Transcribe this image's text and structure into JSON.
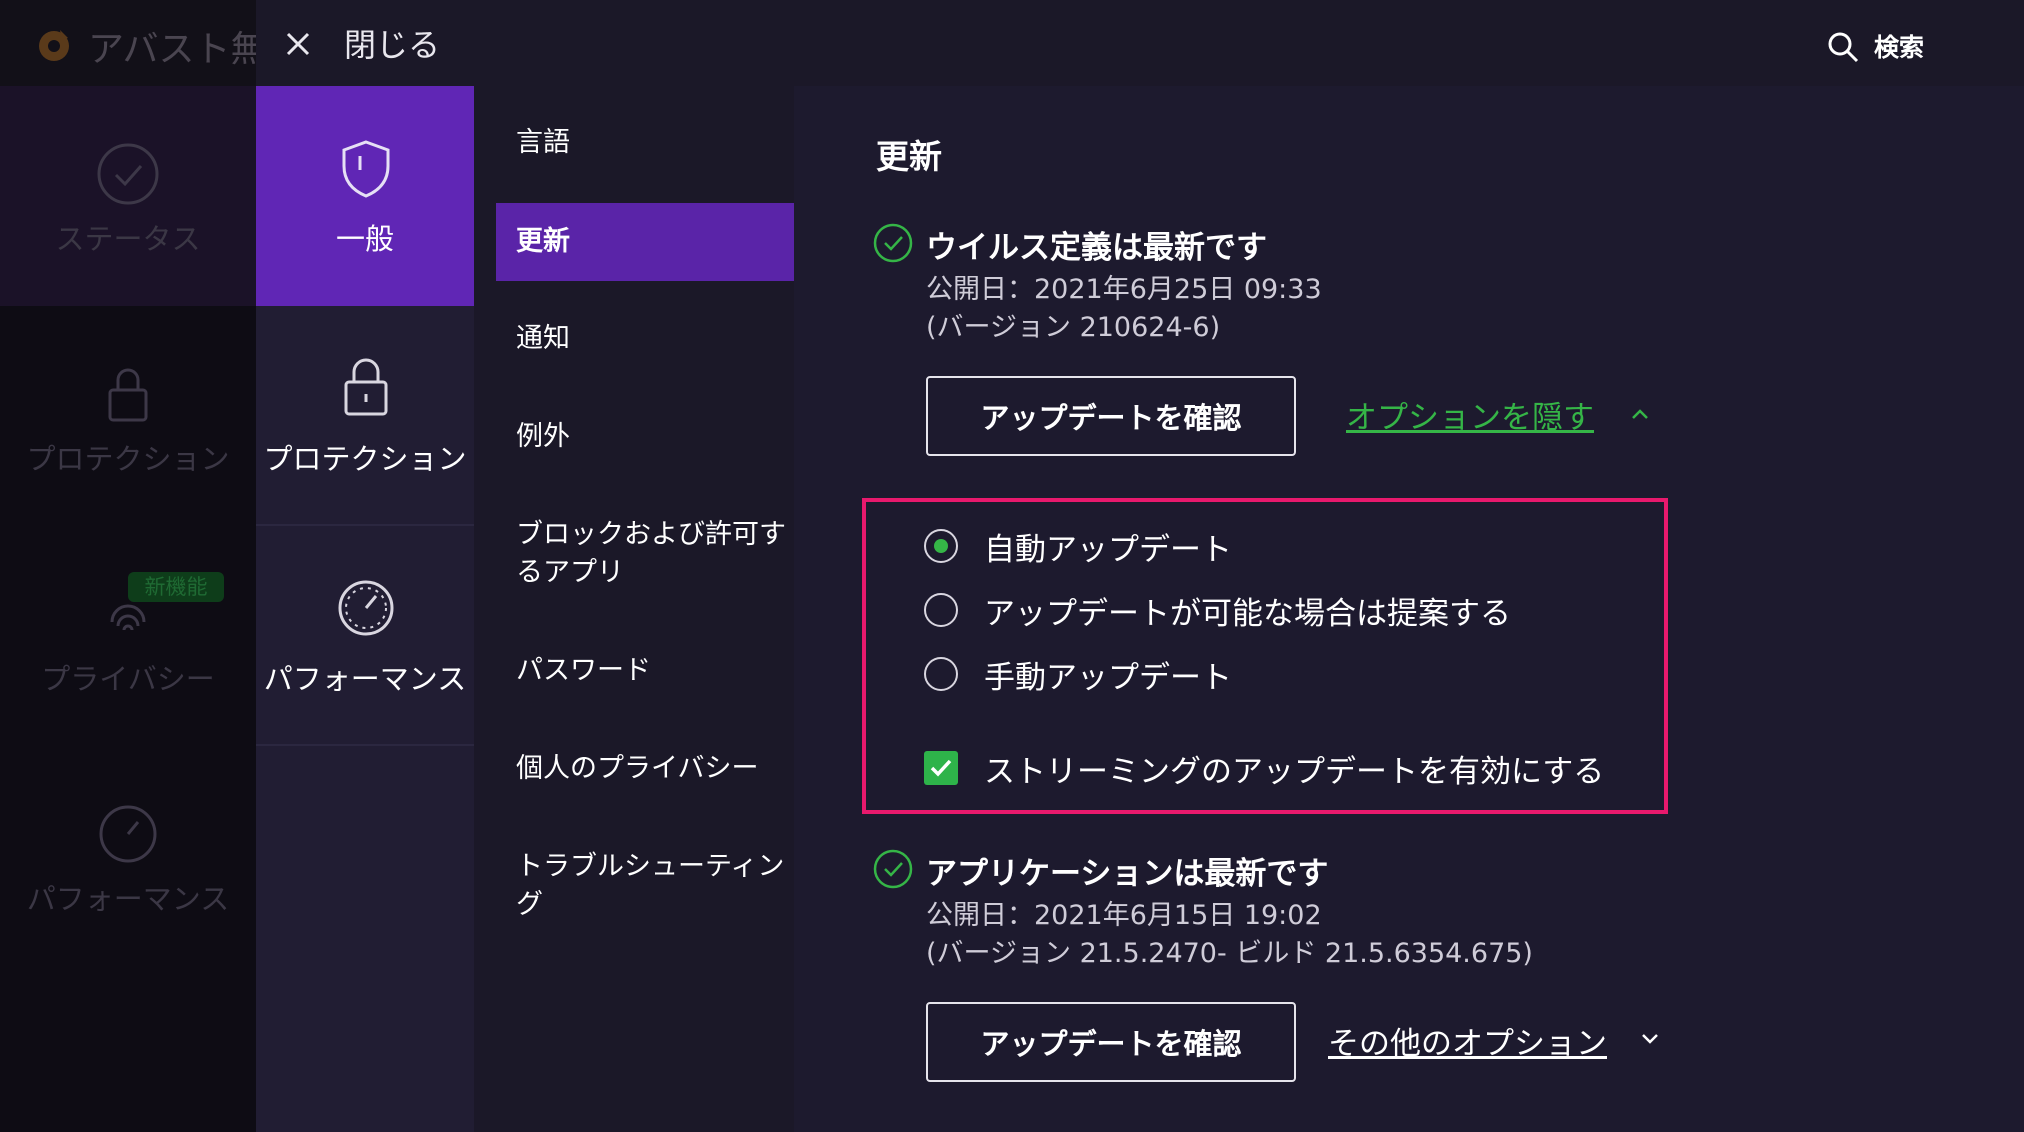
{
  "background_app": {
    "title": "アバスト無料",
    "nav": [
      {
        "label": "ステータス",
        "icon": "check-circle-icon"
      },
      {
        "label": "プロテクション",
        "icon": "lock-icon"
      },
      {
        "label": "プライバシー",
        "icon": "fingerprint-icon"
      },
      {
        "label": "パフォーマンス",
        "icon": "speedometer-icon"
      }
    ],
    "new_badge": "新機能"
  },
  "topbar": {
    "close_label": "閉じる",
    "search_label": "検索"
  },
  "categories": [
    {
      "label": "一般",
      "icon": "shield-icon",
      "active": true
    },
    {
      "label": "プロテクション",
      "icon": "lock-icon",
      "active": false
    },
    {
      "label": "パフォーマンス",
      "icon": "speedometer-icon",
      "active": false
    }
  ],
  "subnav": [
    {
      "label": "言語"
    },
    {
      "label": "更新",
      "active": true
    },
    {
      "label": "通知"
    },
    {
      "label": "例外"
    },
    {
      "label": "ブロックおよび許可するアプリ"
    },
    {
      "label": "パスワード"
    },
    {
      "label": "個人のプライバシー"
    },
    {
      "label": "トラブルシューティング"
    }
  ],
  "content": {
    "title": "更新",
    "virus": {
      "status": "ウイルス定義は最新です",
      "published": "公開日：2021年6月25日 09:33",
      "version": "(バージョン 210624-6)",
      "button": "アップデートを確認",
      "options_link": "オプションを隠す"
    },
    "update_options": [
      {
        "label": "自動アップデート",
        "selected": true
      },
      {
        "label": "アップデートが可能な場合は提案する",
        "selected": false
      },
      {
        "label": "手動アップデート",
        "selected": false
      }
    ],
    "streaming": {
      "label": "ストリーミングのアップデートを有効にする",
      "checked": true
    },
    "app": {
      "status": "アプリケーションは最新です",
      "published": "公開日：2021年6月15日 19:02",
      "version": "(バージョン 21.5.2470- ビルド 21.5.6354.675)",
      "button": "アップデートを確認",
      "options_link": "その他のオプション"
    }
  },
  "colors": {
    "accent_purple": "#6026b5",
    "green": "#35b547",
    "highlight": "#e8196d"
  }
}
